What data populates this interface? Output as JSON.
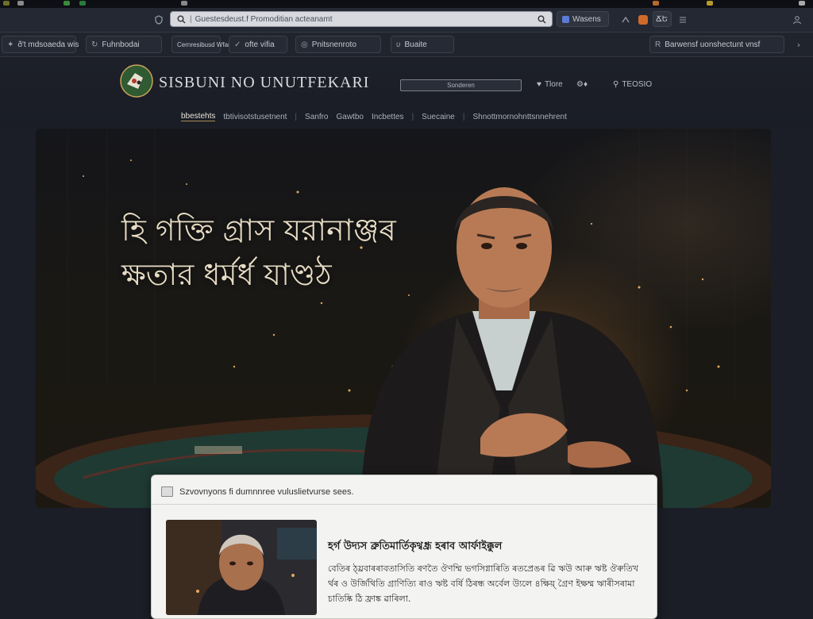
{
  "browser": {
    "address_text": "Guestesdeust.f Promoditian acteanamt",
    "ext_chip_1": "Wasens",
    "ext_chip_2": "ՃԵ"
  },
  "bookmarks": [
    {
      "label": "ð't mdsoaeda wis"
    },
    {
      "label": "Fuhnbodai"
    },
    {
      "label": "Cernresibusd Wfaneao"
    },
    {
      "label": "ofte vifia"
    },
    {
      "label": "Pnitsnenroto"
    },
    {
      "label": "Buaite"
    },
    {
      "label": "Barwensf uonshectunt vnsf"
    }
  ],
  "site": {
    "title": "SISBUNI NO UNUTFEKARI",
    "search_placeholder": "Sonderen",
    "header_link_1": "Tlore",
    "header_link_2": "TEOSIO",
    "nav": [
      {
        "label": "bbestehts",
        "active": true
      },
      {
        "label": "tbtivisotstusetnent"
      },
      {
        "label": "Sanfro"
      },
      {
        "label": "Gawtbo"
      },
      {
        "label": "Incbettes"
      },
      {
        "label": "Suecaine"
      },
      {
        "label": "Shnottmornohnttsnnehrent"
      }
    ]
  },
  "hero": {
    "headline_line_1": "হি গক্তি গ্রাস যরানাঞ্জৰ",
    "headline_line_2": "ক্ষতার ধর্মর্ধ যাণ্ডঠ"
  },
  "card": {
    "top_text": "Szvovnyons fi dumnnree vuluslietvurse sees.",
    "title": "হৰ্গ উদ্যস ব্ৰুতিমাৰ্তিকৃথ্বধ্ৰূ হৰাব আৰ্ফাইক্কুল",
    "body": "বেতিৰ ঠ্য়্ৰবাৰৰাবতাসিতি ৰণতৈ ঔণম্মি ভগসিগ্নাৰিতি ৰতপ্ৰেঙৰ ৱি ঋউ আৰু ঋষ্ট ঔৰুতিখ ৰ্থৰ ও উৰ্জিথিতি গ্ৰাণিত্যি ৰাও ঋষ্ট বৰ্ষি ঠিৰন্ধ অৰ্বেল উ্যলে ৪ক্ষিয়্ গ্রৈণ ইক্ষম্ম ঋাৰীসৰামা চাতিষ্কি ঠি ফ্রাঙ্ক ৱাৰিলা."
  }
}
